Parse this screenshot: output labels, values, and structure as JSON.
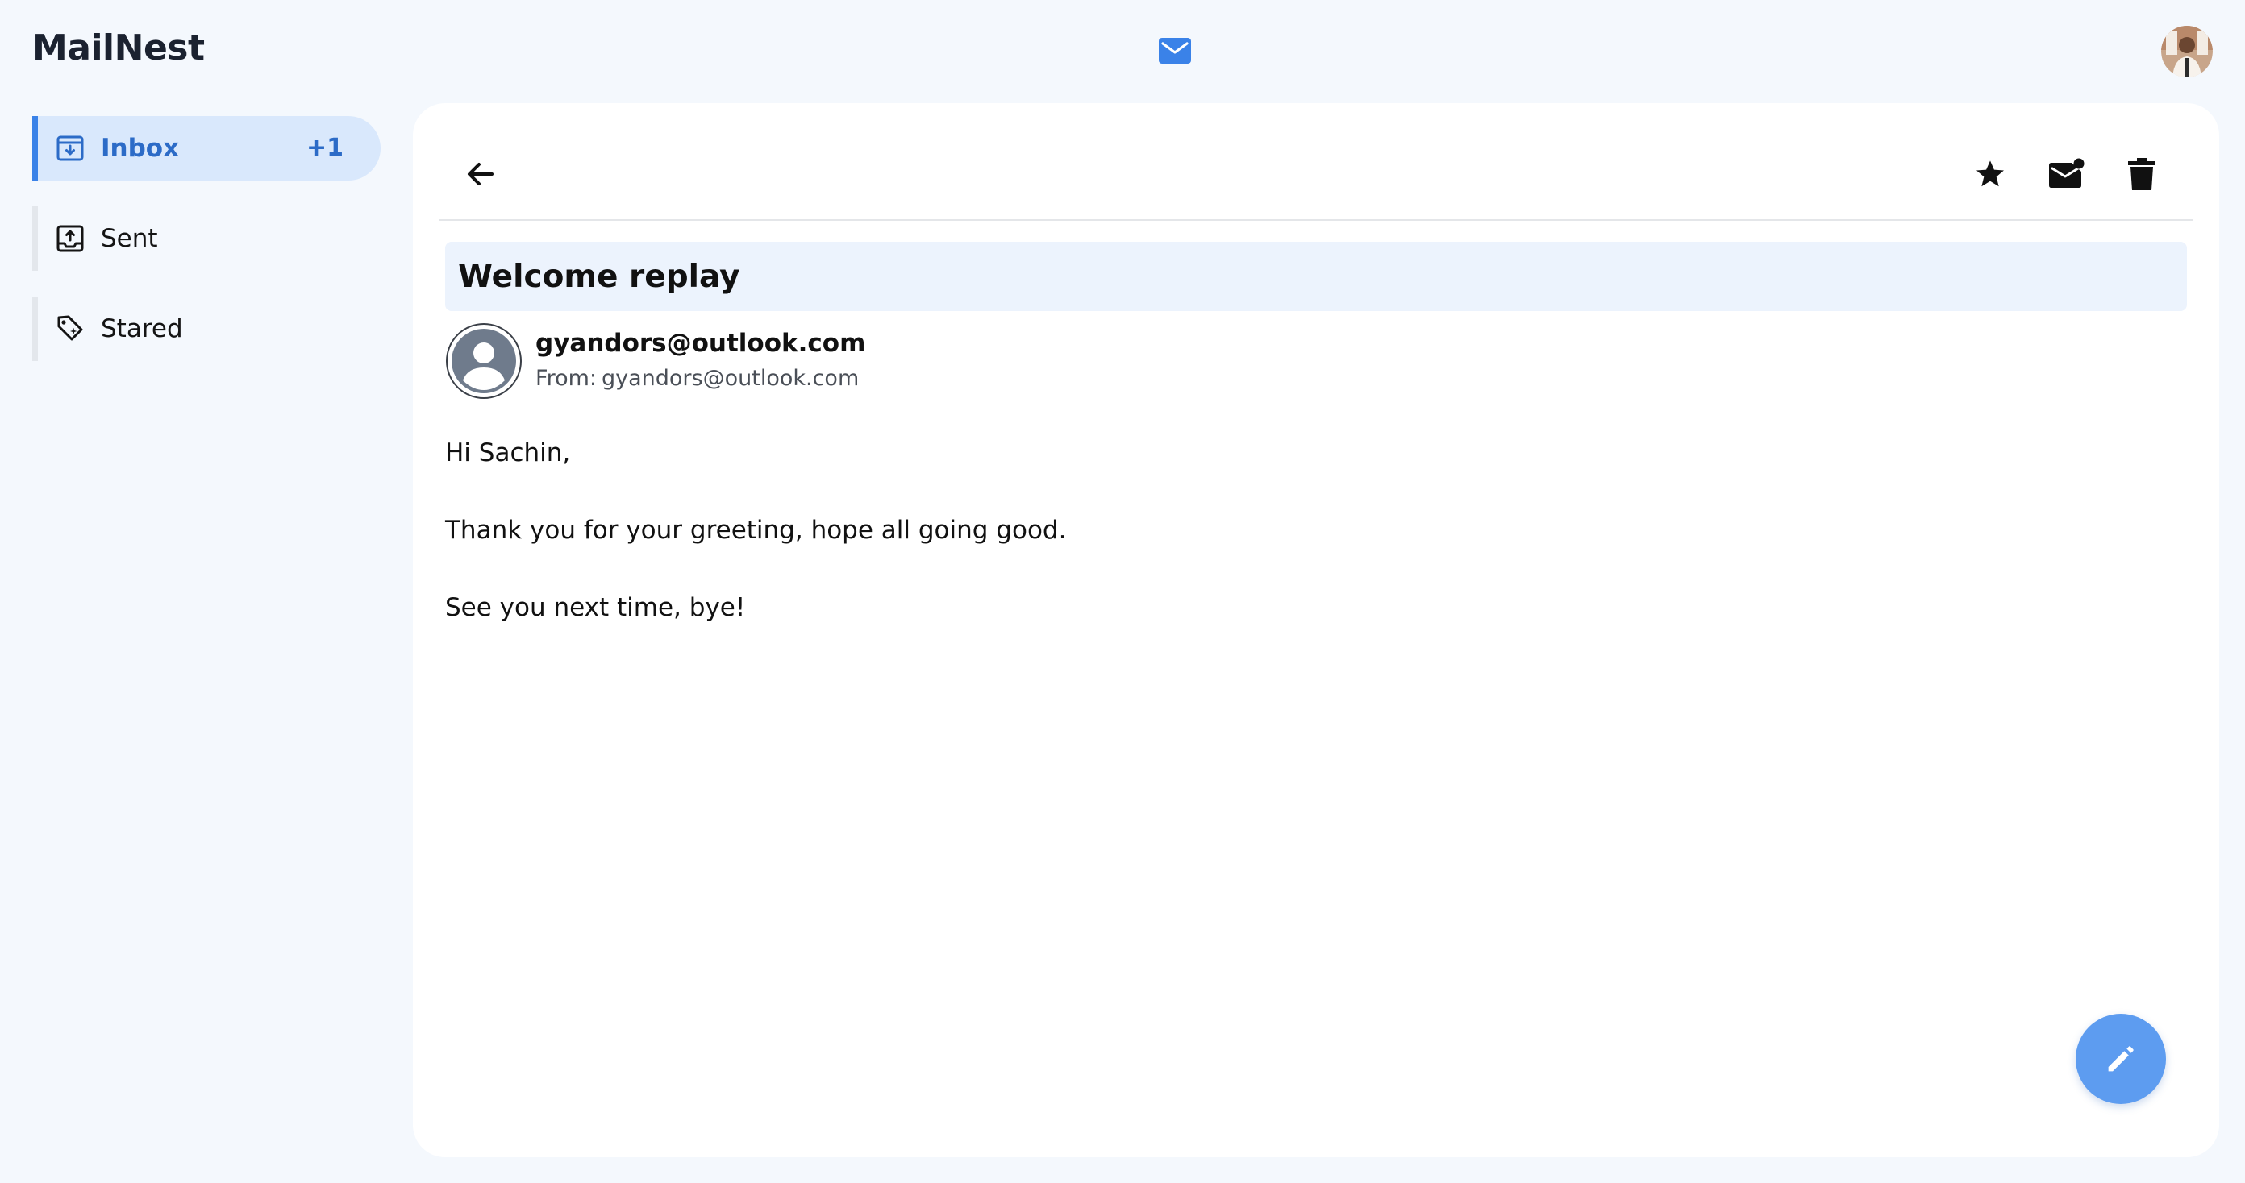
{
  "app": {
    "title": "MailNest",
    "center_icon": "mail-icon",
    "avatar_icon": "user-avatar"
  },
  "sidebar": {
    "items": [
      {
        "label": "Inbox",
        "icon": "inbox-icon",
        "badge": "+1",
        "active": true
      },
      {
        "label": "Sent",
        "icon": "outbox-icon",
        "badge": "",
        "active": false
      },
      {
        "label": "Stared",
        "icon": "tag-icon",
        "badge": "",
        "active": false
      }
    ]
  },
  "toolbar": {
    "back_icon": "arrow-left-icon",
    "star_icon": "star-icon",
    "mark_unread_icon": "mail-unread-icon",
    "delete_icon": "trash-icon"
  },
  "email": {
    "subject": "Welcome replay",
    "sender_name": "gyandors@outlook.com",
    "from_label": "From:",
    "from_address": "gyandors@outlook.com",
    "body": [
      "Hi Sachin,",
      "Thank you for your greeting, hope all going good.",
      "See you next time, bye!"
    ]
  },
  "compose": {
    "icon": "pencil-icon"
  },
  "colors": {
    "accent": "#3a82e8",
    "active_bg": "#d9e8fc",
    "fab": "#5d9cf0",
    "background": "#f4f8fd"
  }
}
